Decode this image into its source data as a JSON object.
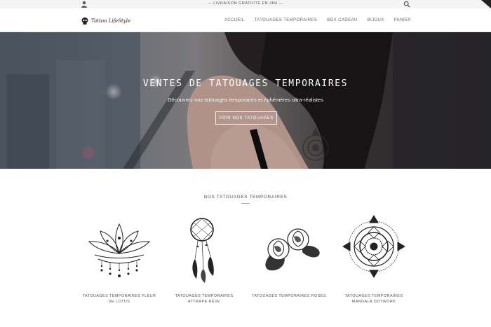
{
  "announcement": {
    "text": "— LIVRAISON GRATUITE EN 48H —"
  },
  "header": {
    "logo_text": "Tattoo LifeStyle",
    "nav": [
      "ACCUEIL",
      "TATOUAGES TEMPORAIRES",
      "BOX CADEAU",
      "BIJOUX",
      "PANIER"
    ]
  },
  "hero": {
    "title": "VENTES DE TATOUAGES TEMPORAIRES",
    "subtitle": "Découvrez nos tatouages temporaires et éphémères ultra-réalistes",
    "cta": "VOIR NOS TATOUAGES"
  },
  "products_section": {
    "title": "NOS TATOUAGES TEMPORAIRES",
    "items": [
      {
        "name": "TATOUAGES TEMPORAIRES FLEUR DE LOTUS",
        "icon": "lotus-tattoo"
      },
      {
        "name": "TATOUAGES TEMPORAIRES ATTRAPE RÊVE",
        "icon": "dreamcatcher-tattoo"
      },
      {
        "name": "TATOUAGES TEMPORAIRES ROSES",
        "icon": "roses-tattoo"
      },
      {
        "name": "TATOUAGES TEMPORAIRES MANDALA DOTWORK",
        "icon": "mandala-tattoo"
      }
    ]
  }
}
